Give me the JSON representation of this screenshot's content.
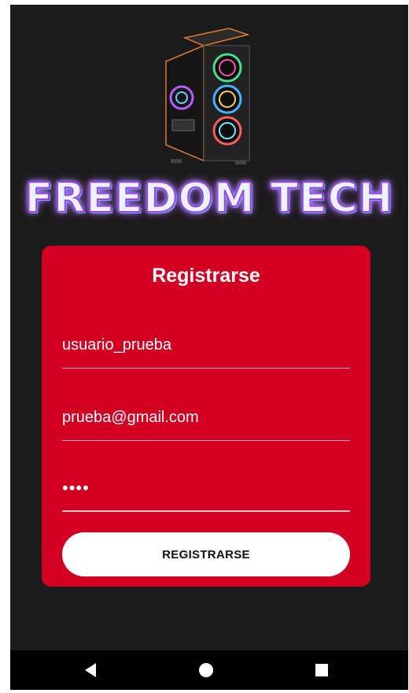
{
  "logo": {
    "text": "FREEDOM TECH"
  },
  "form": {
    "title": "Registrarse",
    "username_value": "usuario_prueba",
    "email_value": "prueba@gmail.com",
    "password_value": "••••",
    "submit_label": "REGISTRARSE"
  },
  "colors": {
    "background": "#1b1b1b",
    "card": "#d30022",
    "button": "#ffffff",
    "navbar": "#000000"
  },
  "navbar": {
    "back_icon": "back-triangle-icon",
    "home_icon": "home-circle-icon",
    "recent_icon": "recent-apps-square-icon"
  }
}
